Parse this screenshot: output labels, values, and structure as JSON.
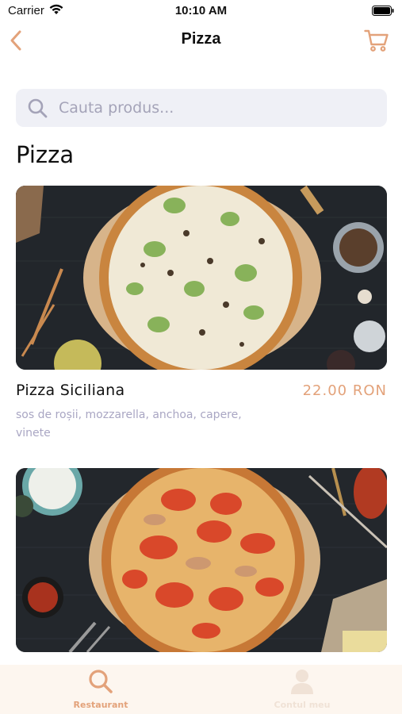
{
  "status_bar": {
    "carrier": "Carrier",
    "time": "10:10 AM"
  },
  "nav": {
    "title": "Pizza",
    "back_icon": "chevron-left-icon",
    "cart_icon": "cart-icon"
  },
  "search": {
    "placeholder": "Cauta produs...",
    "value": ""
  },
  "section": {
    "title": "Pizza"
  },
  "products": [
    {
      "name": "Pizza Siciliana",
      "price": "22.00 RON",
      "description": "sos de roșii, mozzarella, anchoa, capere, vinete"
    },
    {
      "name": "",
      "price": "",
      "description": ""
    }
  ],
  "tab_bar": {
    "items": [
      {
        "label": "Restaurant",
        "icon": "search-icon",
        "active": true
      },
      {
        "label": "Contul meu",
        "icon": "user-icon",
        "active": false
      }
    ]
  },
  "colors": {
    "accent": "#e3a27a",
    "muted": "#a9a6c3",
    "search_bg": "#eff0f6",
    "tab_bg": "#fdf6ef"
  }
}
